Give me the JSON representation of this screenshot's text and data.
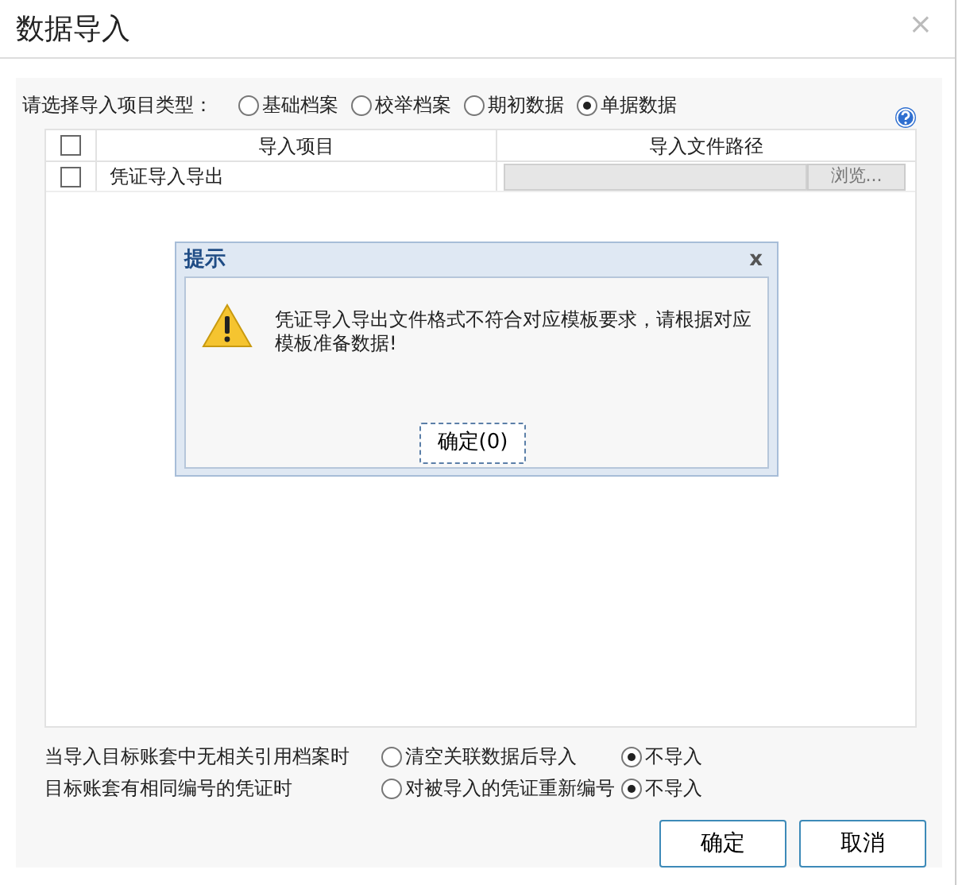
{
  "dialog": {
    "title": "数据导入",
    "close": "×"
  },
  "type_selector": {
    "label": "请选择导入项目类型：",
    "options": [
      {
        "label": "基础档案",
        "selected": false
      },
      {
        "label": "校举档案",
        "selected": false
      },
      {
        "label": "期初数据",
        "selected": false
      },
      {
        "label": "单据数据",
        "selected": true
      }
    ]
  },
  "table": {
    "header_checked": false,
    "columns": [
      "导入项目",
      "导入文件路径"
    ],
    "rows": [
      {
        "checked": false,
        "item": "凭证导入导出",
        "browse": "浏览...",
        "disabled": true
      }
    ]
  },
  "alert": {
    "title": "提示",
    "close": "x",
    "message": "凭证导入导出文件格式不符合对应模板要求，请根据对应模板准备数据!",
    "button": "确定(0)"
  },
  "settings": [
    {
      "label": "当导入目标账套中无相关引用档案时",
      "choices": [
        {
          "label": "清空关联数据后导入",
          "selected": false
        },
        {
          "label": "不导入",
          "selected": true
        }
      ]
    },
    {
      "label": "目标账套有相同编号的凭证时",
      "choices": [
        {
          "label": "对被导入的凭证重新编号",
          "selected": false
        },
        {
          "label": "不导入",
          "selected": true
        }
      ]
    }
  ],
  "buttons": [
    "确定",
    "取消"
  ]
}
